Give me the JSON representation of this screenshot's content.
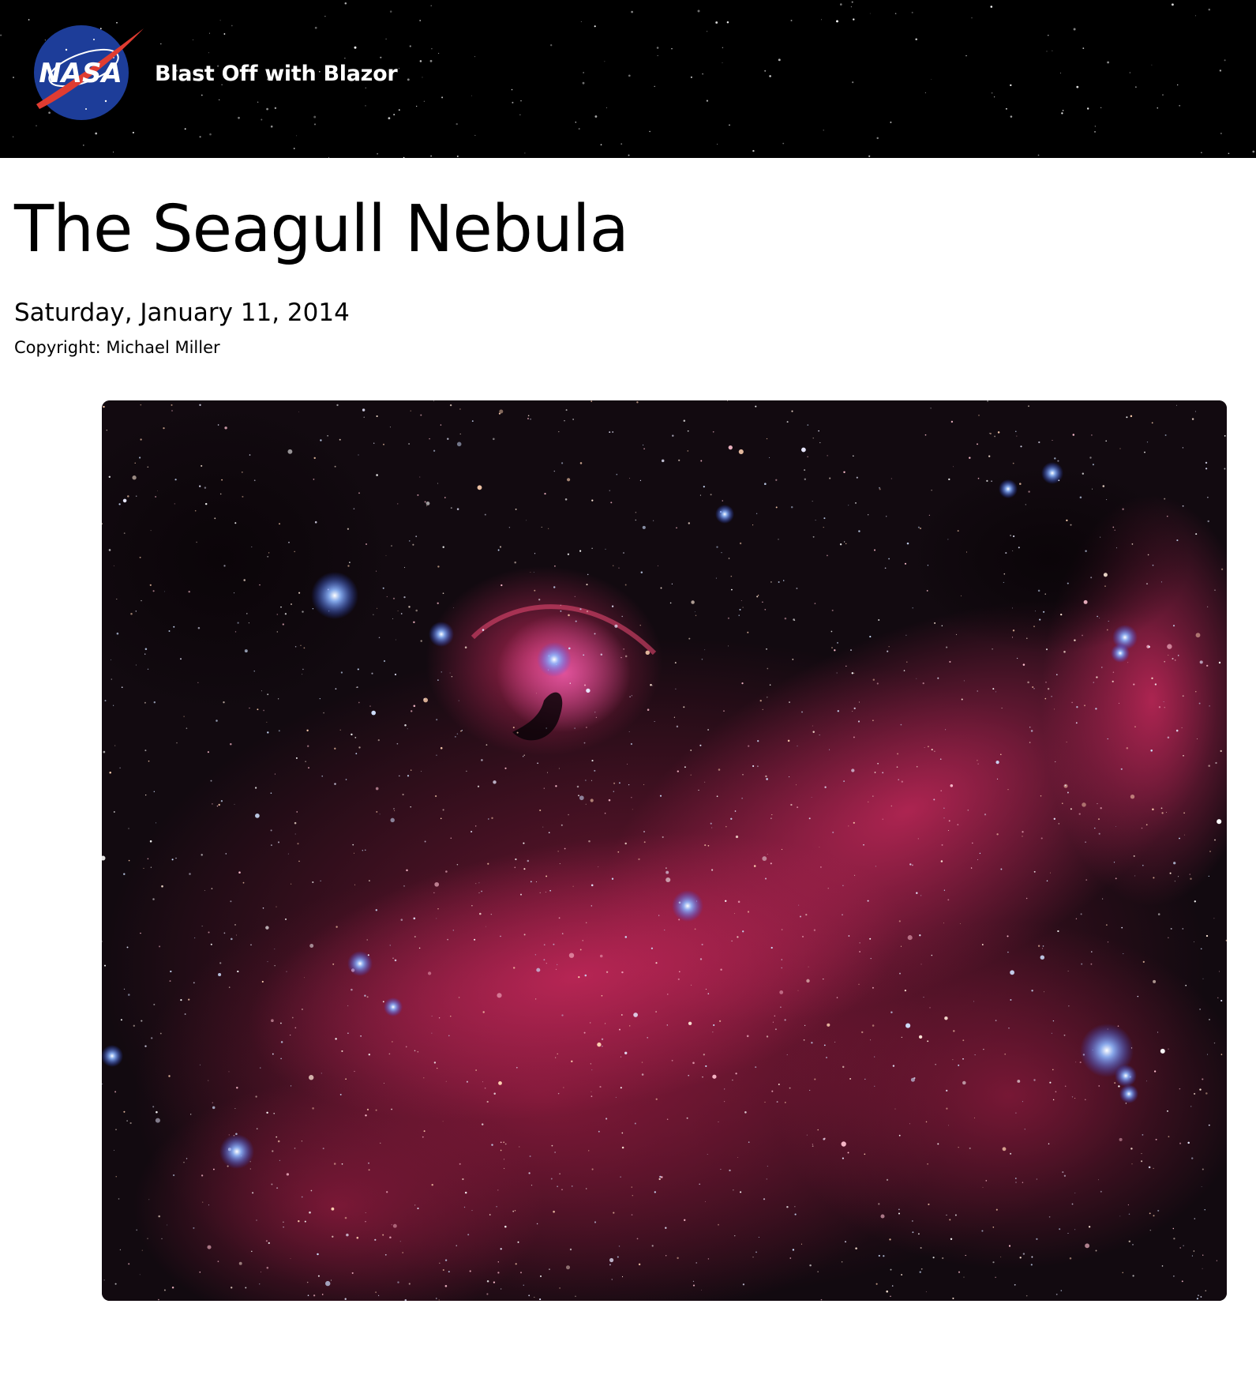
{
  "header": {
    "logo_alt": "NASA",
    "logo_text": "NASA",
    "app_title": "Blast Off with Blazor"
  },
  "apod": {
    "title": "The Seagull Nebula",
    "date": "Saturday, January 11, 2014",
    "copyright": "Copyright: Michael Miller",
    "image_subject": "Seagull Nebula astrophotograph"
  },
  "colors": {
    "header_bg": "#000000",
    "nasa_blue": "#1d3d99",
    "nasa_red": "#e03c31",
    "nebula_red": "#b01e44",
    "nebula_pink": "#e0468a"
  }
}
